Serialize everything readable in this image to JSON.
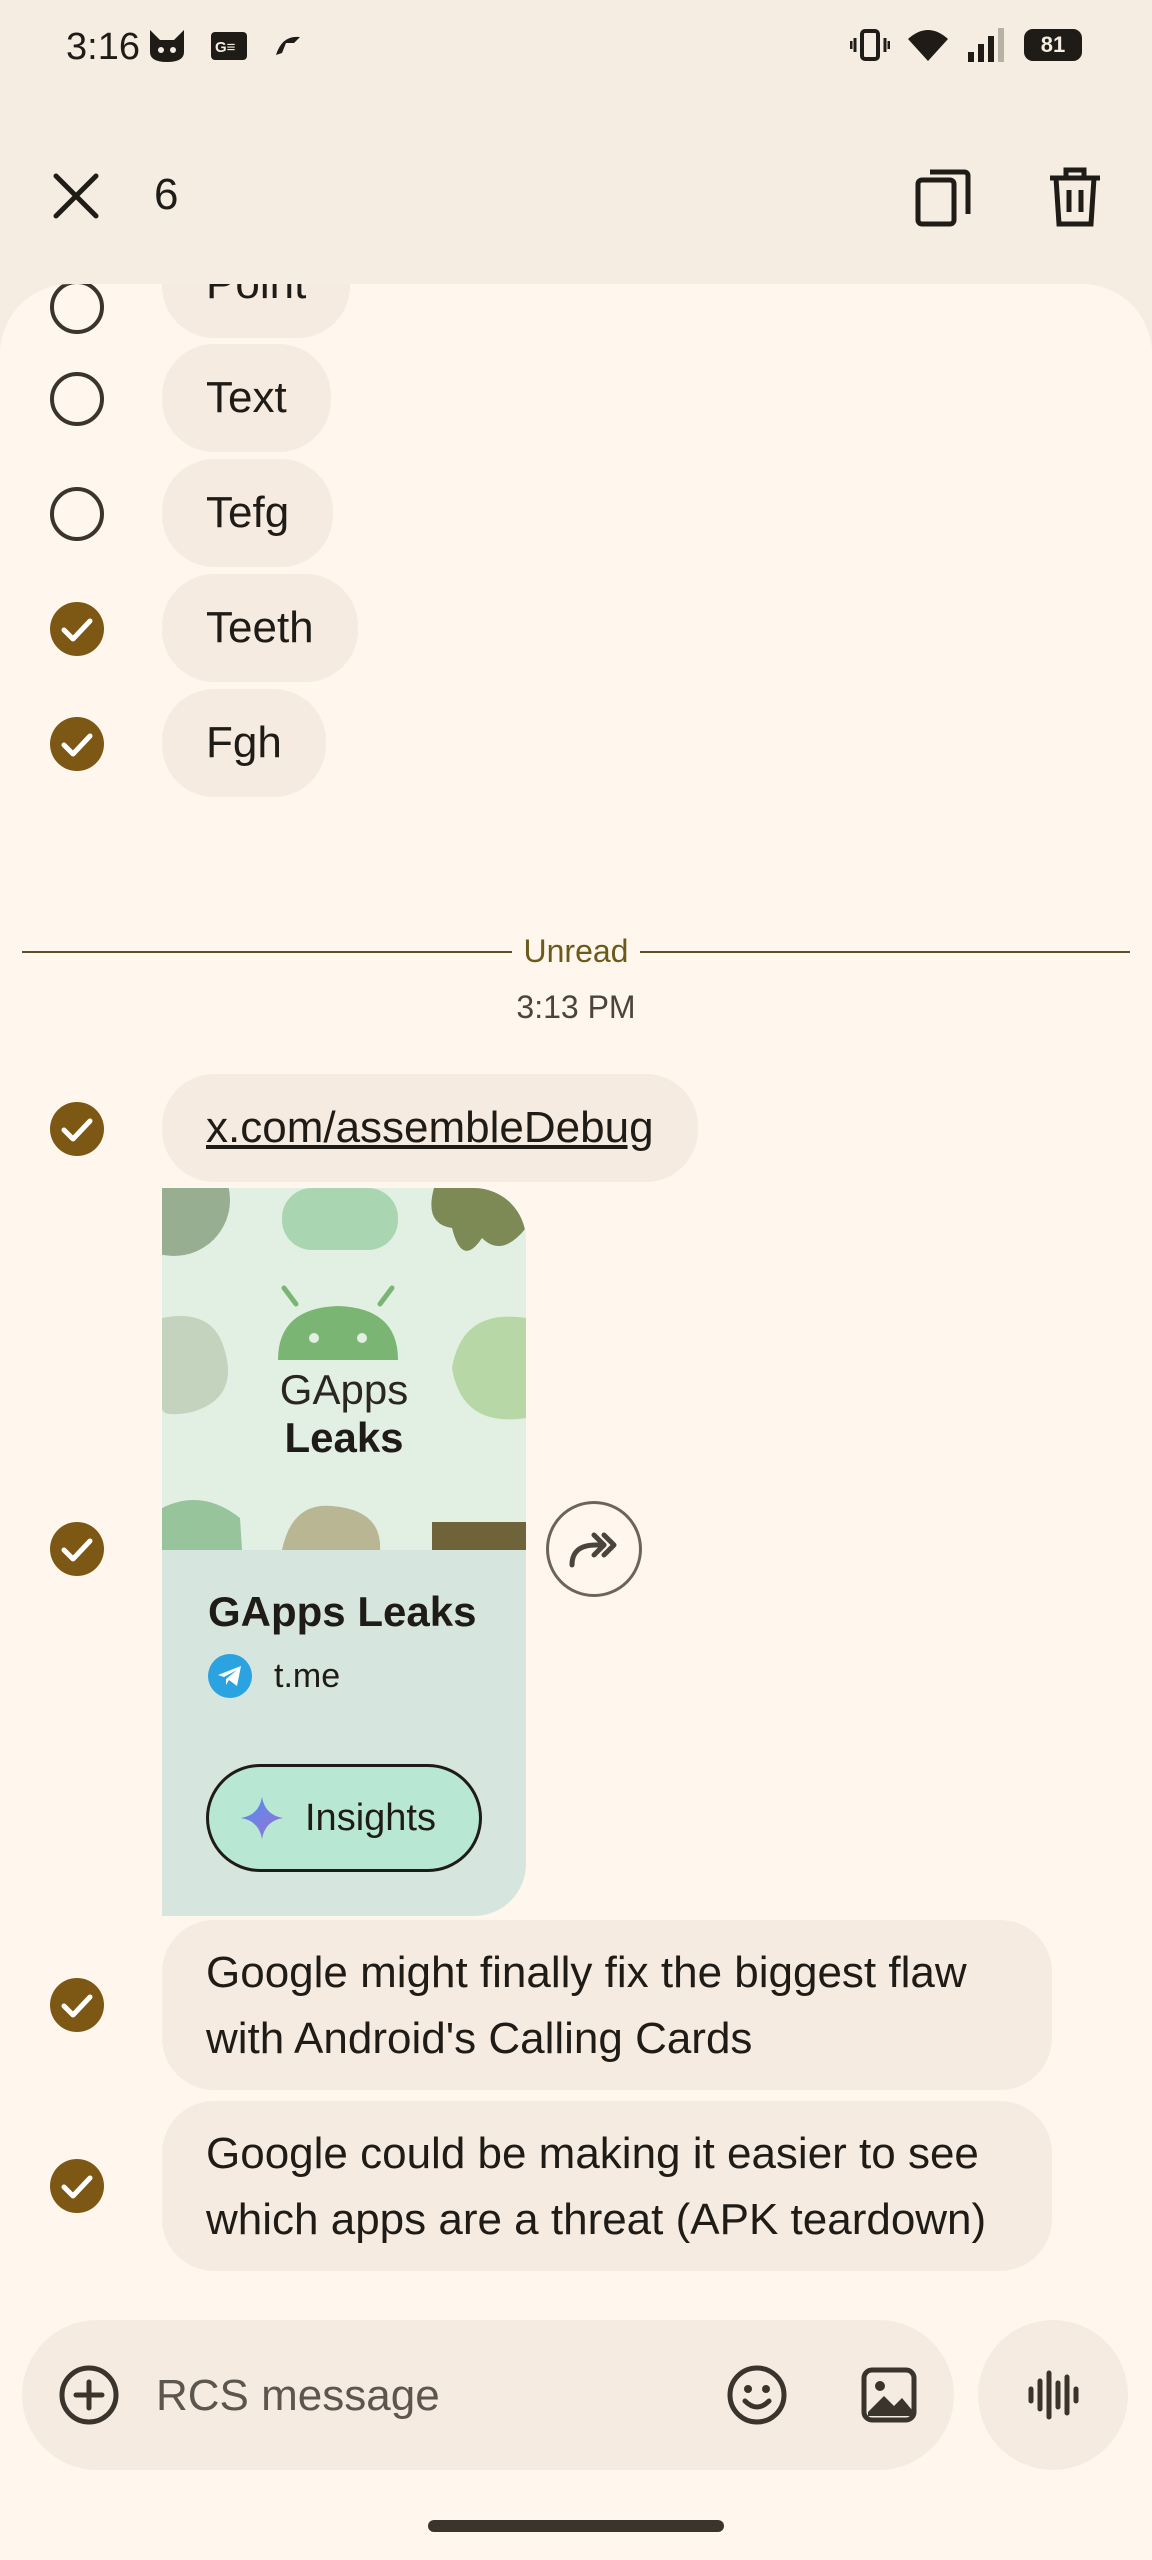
{
  "status": {
    "time": "3:16",
    "battery": "81"
  },
  "header": {
    "selected_count": "6"
  },
  "messages_top": [
    {
      "text": "Point",
      "selected": false
    },
    {
      "text": "Text",
      "selected": false
    },
    {
      "text": "Tefg",
      "selected": false
    },
    {
      "text": "Teeth",
      "selected": true
    },
    {
      "text": "Fgh",
      "selected": true
    }
  ],
  "divider": {
    "label": "Unread"
  },
  "timestamp": "3:13 PM",
  "link_message": {
    "text": "x.com/assembleDebug",
    "selected": true
  },
  "link_card": {
    "image_line1": "GApps",
    "image_line2": "Leaks",
    "title": "GApps Leaks",
    "source": "t.me",
    "insights_label": "Insights",
    "selected": true
  },
  "messages_bottom": [
    {
      "text": "Google might finally fix the biggest flaw with Android's Calling Cards",
      "selected": true
    },
    {
      "text": "Google could be making it easier to see which apps are a threat (APK teardown)",
      "selected": true
    }
  ],
  "composer": {
    "placeholder": "RCS message"
  },
  "colors": {
    "accent": "#7d5814",
    "background": "#fff6ee",
    "bubble": "#f5ebe1",
    "card": "#d6e6de"
  }
}
